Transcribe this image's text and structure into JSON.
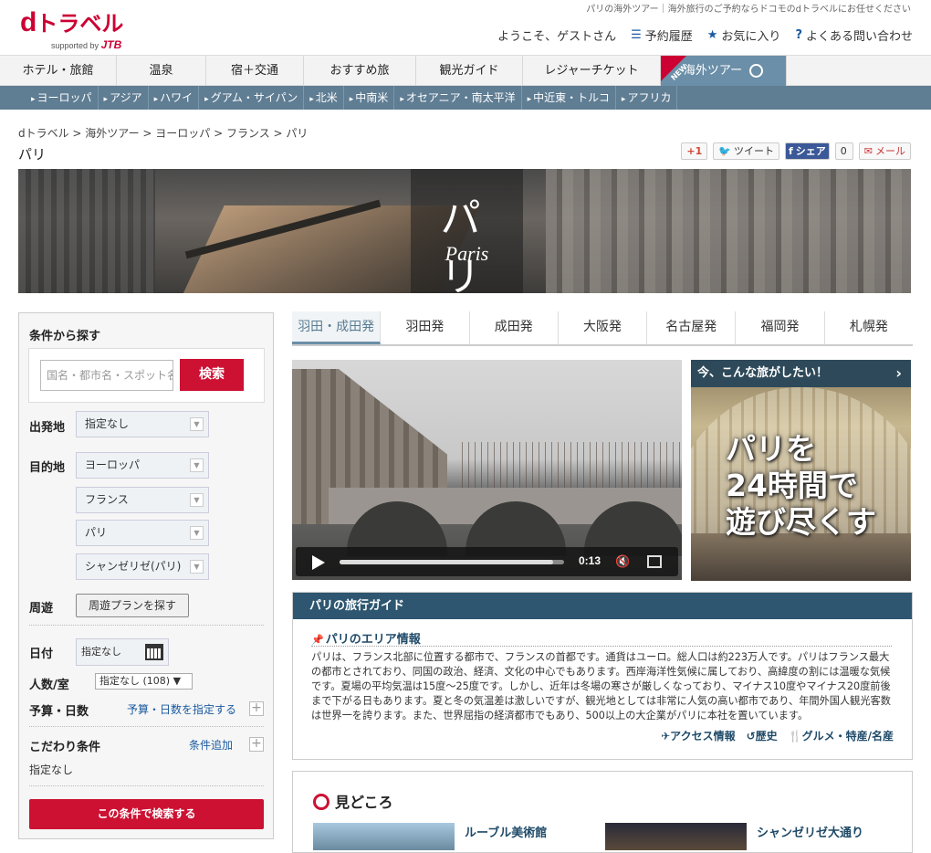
{
  "header": {
    "logo_d": "d",
    "logo_brand": "トラベル",
    "supported_by": "supported by",
    "jtb": "JTB",
    "tagline": "パリの海外ツアー｜海外旅行のご予約ならドコモのdトラベルにお任せください",
    "welcome": "ようこそ、ゲストさん",
    "links": {
      "reservations": "予約履歴",
      "favorites": "お気に入り",
      "faq": "よくある問い合わせ"
    }
  },
  "main_nav": [
    {
      "label": "ホテル・旅館"
    },
    {
      "label": "温泉"
    },
    {
      "label": "宿＋交通"
    },
    {
      "label": "おすすめ旅"
    },
    {
      "label": "観光ガイド"
    },
    {
      "label": "レジャーチケット"
    },
    {
      "label": "海外ツアー",
      "badge": "NEW",
      "active": true
    }
  ],
  "sub_nav": [
    "ヨーロッパ",
    "アジア",
    "ハワイ",
    "グアム・サイパン",
    "北米",
    "中南米",
    "オセアニア・南太平洋",
    "中近東・トルコ",
    "アフリカ"
  ],
  "breadcrumb": "dトラベル  >  海外ツアー  >  ヨーロッパ  >  フランス  >  パリ",
  "page_title": "パリ",
  "share": {
    "gplus": "+1",
    "tweet": "ツイート",
    "fb": "シェア",
    "fb_count": "0",
    "mail": "メール"
  },
  "hero": {
    "title_ja": "パ リ",
    "title_en": "Paris"
  },
  "sidebar": {
    "title": "条件から探す",
    "search_placeholder": "国名・都市名・スポット名",
    "search_button": "検索",
    "departure_label": "出発地",
    "departure_value": "指定なし",
    "destination_label": "目的地",
    "dest_region": "ヨーロッパ",
    "dest_country": "フランス",
    "dest_city": "パリ",
    "dest_area": "シャンゼリゼ(パリ)",
    "tour_label": "周遊",
    "tour_button": "周遊プランを探す",
    "date_label": "日付",
    "date_value": "指定なし",
    "people_label": "人数/室",
    "people_value": "指定なし (108)",
    "budget_label": "予算・日数",
    "budget_link": "予算・日数を指定する",
    "pref_label": "こだわり条件",
    "pref_link": "条件追加",
    "pref_value": "指定なし",
    "submit": "この条件で検索する"
  },
  "departure_tabs": [
    {
      "label": "羽田・成田発",
      "active": true
    },
    {
      "label": "羽田発"
    },
    {
      "label": "成田発"
    },
    {
      "label": "大阪発"
    },
    {
      "label": "名古屋発"
    },
    {
      "label": "福岡発"
    },
    {
      "label": "札幌発"
    }
  ],
  "video": {
    "time": "0:13",
    "progress": 0.95
  },
  "feature": {
    "header": "今、こんな旅がしたい！",
    "line1": "パリを",
    "line2": "24時間で",
    "line3": "遊び尽くす"
  },
  "guide": {
    "header": "パリの旅行ガイド",
    "area_title": "パリのエリア情報",
    "body": "パリは、フランス北部に位置する都市で、フランスの首都です。通貨はユーロ。総人口は約223万人です。パリはフランス最大の都市とされており、同国の政治、経済、文化の中心でもあります。西岸海洋性気候に属しており、高緯度の割には温暖な気候です。夏場の平均気温は15度〜25度です。しかし、近年は冬場の寒さが厳しくなっており、マイナス10度やマイナス20度前後まで下がる日もあります。夏と冬の気温差は激しいですが、観光地としては非常に人気の高い都市であり、年間外国人観光客数は世界一を誇ります。また、世界屈指の経済都市でもあり、500以上の大企業がパリに本社を置いています。",
    "links": {
      "access": "アクセス情報",
      "history": "歴史",
      "gourmet": "グルメ・特産/名産"
    }
  },
  "spots": {
    "title": "見どころ",
    "spot1": "ルーブル美術館",
    "spot2": "シャンゼリゼ大通り"
  }
}
